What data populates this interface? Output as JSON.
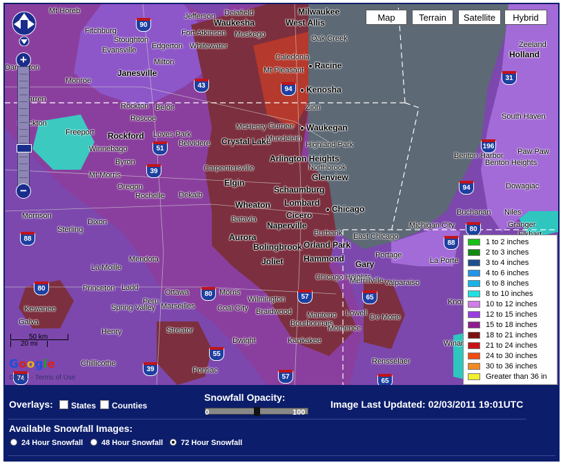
{
  "map": {
    "map_types": [
      "Map",
      "Terrain",
      "Satellite",
      "Hybrid"
    ],
    "cities_major": [
      "Milwaukee",
      "Kenosha",
      "Racine",
      "Waukegan",
      "Crystal Lake",
      "Rockford",
      "Arlington Heights",
      "Glenview",
      "Elgin",
      "Schaumburg",
      "Chicago",
      "Wheaton",
      "Lombard",
      "Cicero",
      "Naperville",
      "Aurora",
      "Bolingbrook",
      "Orland Park",
      "Hammond",
      "Joliet",
      "Gary",
      "Janesville",
      "Waukesha",
      "West Allis",
      "Holland"
    ],
    "cities_minor": [
      "Mt Horeb",
      "Jefferson",
      "Delafield",
      "Fitchburg",
      "Stoughton",
      "Fort Atkinson",
      "Muskego",
      "Oak Creek",
      "Evansville",
      "Edgerton",
      "Whitewater",
      "Caledonia",
      "Zeeland",
      "Milton",
      "Mt Pleasant",
      "Darlington",
      "Monroe",
      "Warren",
      "Rockton",
      "Beloit",
      "Zion",
      "Stockton",
      "Roscoe",
      "Gurnee",
      "McHenry",
      "Mundelein",
      "Highland Park",
      "Freeport",
      "Loves Park",
      "Belvidere",
      "Winnebago",
      "Byron",
      "Carpentersville",
      "Northbrook",
      "Mt Morris",
      "Oregon",
      "Rochelle",
      "Dekalb",
      "Batavia",
      "Morrison",
      "Dixon",
      "Sterling",
      "Burbank",
      "East Chicago",
      "Portage",
      "La Porte",
      "La Moille",
      "Mendota",
      "Chicago Heights",
      "Merrillville",
      "Valparaiso",
      "Princeton",
      "Ladd",
      "Ottawa",
      "Morris",
      "Wilmington",
      "Peru",
      "Marseilles",
      "Spring Valley",
      "Coal City",
      "Braidwood",
      "Manteno",
      "Lowell",
      "De Motte",
      "Kewanee",
      "Galva",
      "Henry",
      "Streator",
      "Dwight",
      "Bourbonnais",
      "Momence",
      "Kankakee",
      "Chillicothe",
      "Pontiac",
      "Rensselaer",
      "South Haven",
      "Benton Harbor",
      "Benton Heights",
      "Paw Paw",
      "Dowagiac",
      "Buchanan",
      "Niles",
      "Granger",
      "Michigan City",
      "Winamac",
      "Knox",
      "Elkhart"
    ],
    "shields": [
      "90",
      "43",
      "94",
      "51",
      "39",
      "88",
      "80",
      "57",
      "65",
      "55",
      "74",
      "196",
      "31"
    ],
    "scale_km": "50 km",
    "scale_mi": "20 mi",
    "google_logo": "Google",
    "copyright": "©2011 - Terms of Use",
    "nav_icons": [
      "pan-up-icon",
      "pan-left-icon",
      "pan-right-icon",
      "pan-down-icon",
      "zoom-in-icon",
      "zoom-out-icon"
    ]
  },
  "legend": {
    "items": [
      {
        "label": "1 to 2 inches",
        "color": "#16c016"
      },
      {
        "label": "2 to 3 inches",
        "color": "#118a11"
      },
      {
        "label": "3 to 4 inches",
        "color": "#1d4f8e"
      },
      {
        "label": "4 to 6 inches",
        "color": "#2196e8"
      },
      {
        "label": "6 to 8 inches",
        "color": "#19b3e8"
      },
      {
        "label": "8 to 10 inches",
        "color": "#22e0e0"
      },
      {
        "label": "10 to 12 inches",
        "color": "#d07de8"
      },
      {
        "label": "12 to 15 inches",
        "color": "#9a3ee0"
      },
      {
        "label": "15 to 18 inches",
        "color": "#8e1e8e"
      },
      {
        "label": "18 to 21 inches",
        "color": "#7c1212"
      },
      {
        "label": "21 to 24 inches",
        "color": "#c81414"
      },
      {
        "label": "24 to 30 inches",
        "color": "#f04b12"
      },
      {
        "label": "30 to 36 inches",
        "color": "#f08a22"
      },
      {
        "label": "Greater than 36 in",
        "color": "#f0f030"
      }
    ]
  },
  "panel": {
    "overlays_label": "Overlays:",
    "states_label": "States",
    "counties_label": "Counties",
    "opacity_label": "Snowfall Opacity:",
    "opacity_min": "0",
    "opacity_max": "100",
    "opacity_value": 0.5,
    "updated_label": "Image Last Updated: 02/03/2011 19:01UTC",
    "images_label": "Available Snowfall Images:",
    "radios": [
      "24 Hour Snowfall",
      "48 Hour Snowfall",
      "72 Hour Snowfall"
    ],
    "selected": "72 Hour Snowfall"
  }
}
